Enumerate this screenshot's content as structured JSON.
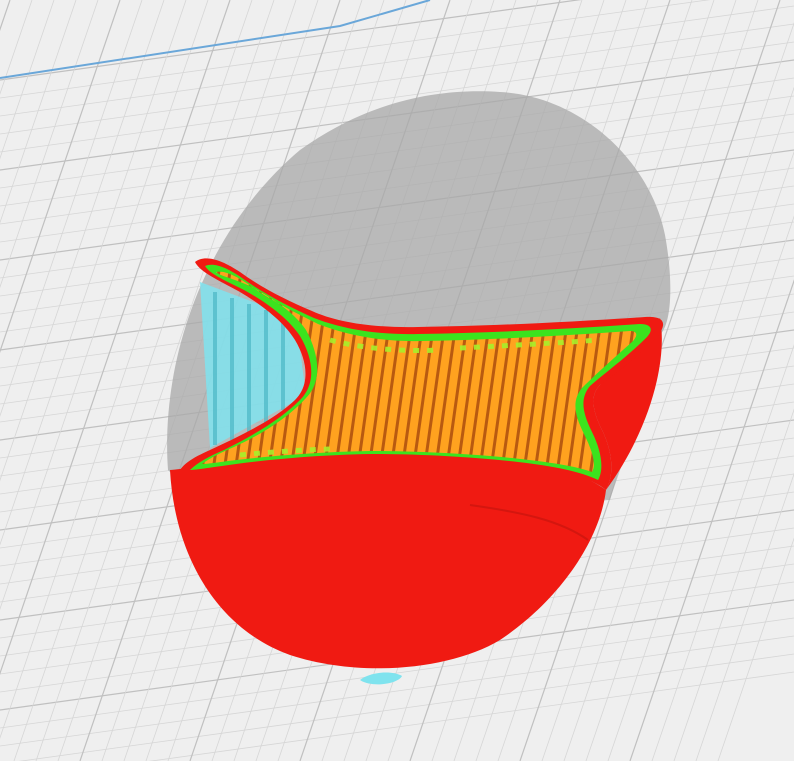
{
  "viewport": {
    "view": "layer-view",
    "colors": {
      "build_plate": "#efefef",
      "plate_edge": "#6aa7d9",
      "grid_minor": "#d6d6d6",
      "grid_major": "#c0c0c0",
      "ghost_model": "#a8a8a8",
      "outer_wall": "#f01a12",
      "inner_wall": "#3ce31e",
      "infill": "#ffa21f",
      "infill_line": "#b85a10",
      "skin_accent": "#a6ef2a",
      "support": "#7fe3ee"
    },
    "legend": [
      "outer-wall",
      "inner-wall",
      "infill",
      "support",
      "ghost-model"
    ]
  }
}
